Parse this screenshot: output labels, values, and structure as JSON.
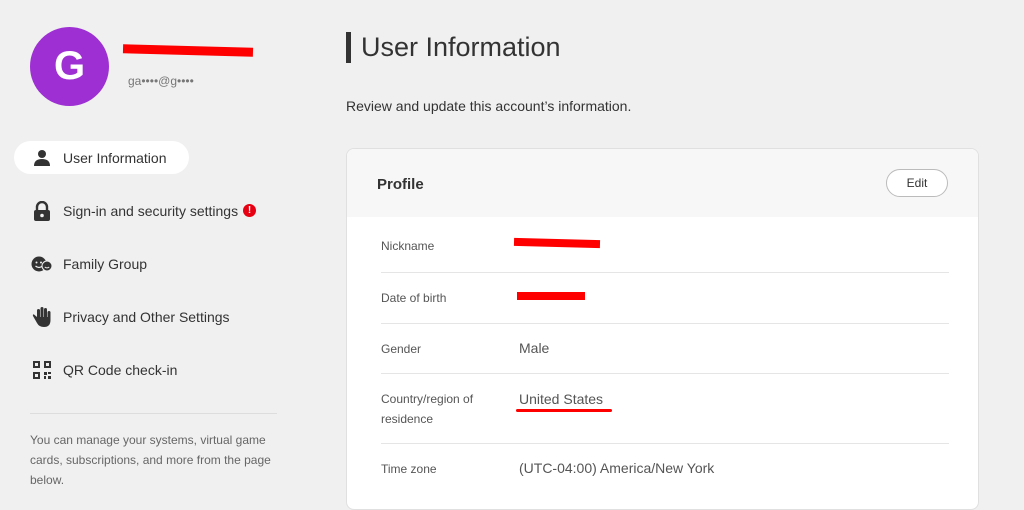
{
  "user": {
    "avatar_letter": "G",
    "email_masked": "ga••••@g••••"
  },
  "sidebar": {
    "items": [
      {
        "label": "User Information",
        "icon": "person-icon",
        "active": true
      },
      {
        "label": "Sign-in and security settings",
        "icon": "lock-icon",
        "alert": "!"
      },
      {
        "label": "Family Group",
        "icon": "family-icon"
      },
      {
        "label": "Privacy and Other Settings",
        "icon": "hand-icon"
      },
      {
        "label": "QR Code check-in",
        "icon": "qr-code-icon"
      }
    ],
    "note": "You can manage your systems, virtual game cards, subscriptions, and more from the page below."
  },
  "main": {
    "title": "User Information",
    "subtitle": "Review and update this account’s information.",
    "profile": {
      "title": "Profile",
      "edit_label": "Edit",
      "fields": [
        {
          "label": "Nickname",
          "value": ""
        },
        {
          "label": "Date of birth",
          "value": ""
        },
        {
          "label": "Gender",
          "value": "Male"
        },
        {
          "label": "Country/region of residence",
          "value": "United States"
        },
        {
          "label": "Time zone",
          "value": "(UTC-04:00) America/New York"
        }
      ]
    }
  },
  "colors": {
    "avatar": "#9d2fd3",
    "redaction": "#ff0000",
    "alert": "#e60012"
  }
}
